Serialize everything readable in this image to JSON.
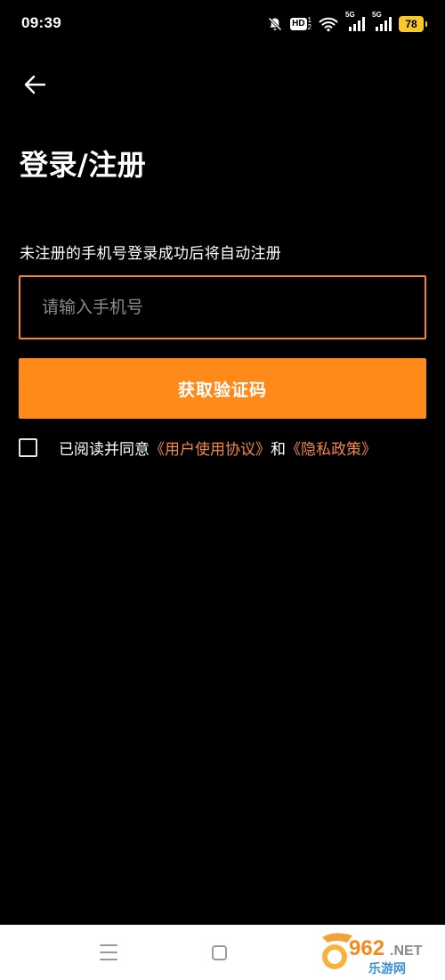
{
  "status_bar": {
    "time": "09:39",
    "hd_label": "HD",
    "hd_sub_top": "1",
    "hd_sub_bottom": "2",
    "signal1_label": "5G",
    "signal2_label": "5G",
    "battery": "78",
    "icons": [
      "mute-bell-icon",
      "hd-icon",
      "wifi-icon",
      "signal-icon",
      "signal-icon",
      "battery-icon"
    ]
  },
  "header": {
    "back_icon": "back-arrow-icon",
    "title": "登录/注册"
  },
  "form": {
    "hint": "未注册的手机号登录成功后将自动注册",
    "phone_value": "",
    "phone_placeholder": "请输入手机号",
    "get_code_label": "获取验证码"
  },
  "agreement": {
    "prefix": "已阅读并同意",
    "user_agreement": "《用户使用协议》",
    "conjunction": "和",
    "privacy_policy": "《隐私政策》",
    "checked": false
  },
  "nav_bar": {
    "icons": [
      "menu-icon",
      "home-icon"
    ]
  },
  "watermark": {
    "brand": "962.NET",
    "sub": "乐游网"
  },
  "colors": {
    "accent": "#FF8A1A",
    "input_border": "#F28A1E",
    "link": "#F2874E",
    "battery": "#F8C82A",
    "background": "#000000"
  }
}
